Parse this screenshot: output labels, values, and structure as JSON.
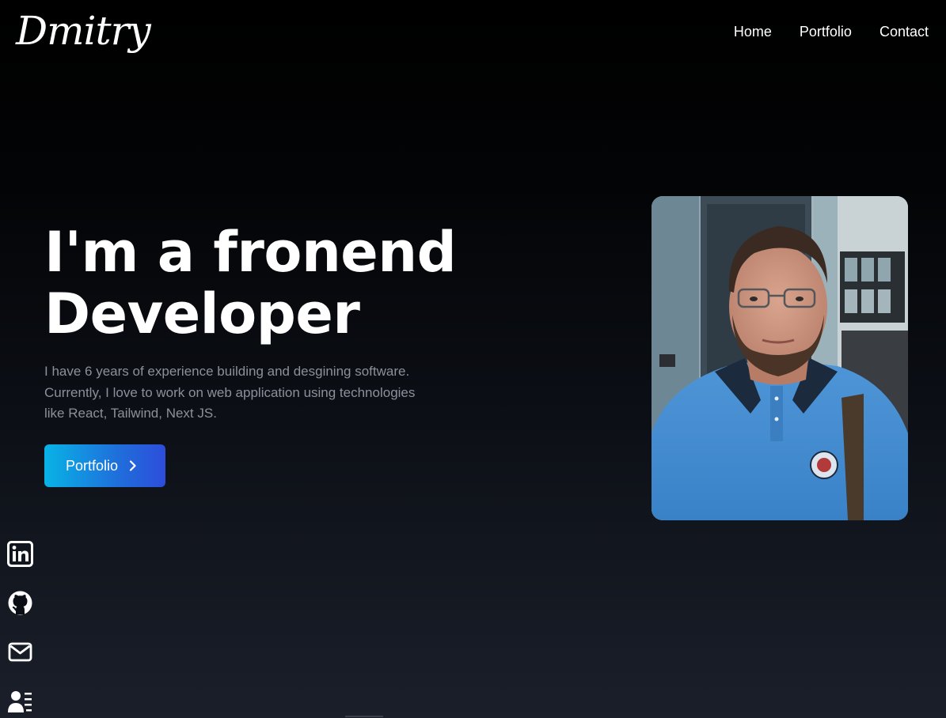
{
  "header": {
    "logo_text": "Dmitry",
    "nav": [
      {
        "label": "Home"
      },
      {
        "label": "Portfolio"
      },
      {
        "label": "Contact"
      }
    ]
  },
  "hero": {
    "title_line1": "I'm a fronend",
    "title_line2": "Developer",
    "description": "I have 6 years of experience building and desgining software. Currently, I love to work on web application using technologies like React, Tailwind, Next JS.",
    "cta_label": "Portfolio"
  },
  "social": [
    {
      "icon": "linkedin-icon"
    },
    {
      "icon": "github-icon"
    },
    {
      "icon": "mail-icon"
    },
    {
      "icon": "resume-icon"
    }
  ],
  "colors": {
    "background_top": "#000000",
    "background_bottom": "#1a1f2a",
    "text_primary": "#ffffff",
    "text_muted": "#8d909a",
    "accent_start": "#08b3e6",
    "accent_end": "#2d4ddb"
  }
}
